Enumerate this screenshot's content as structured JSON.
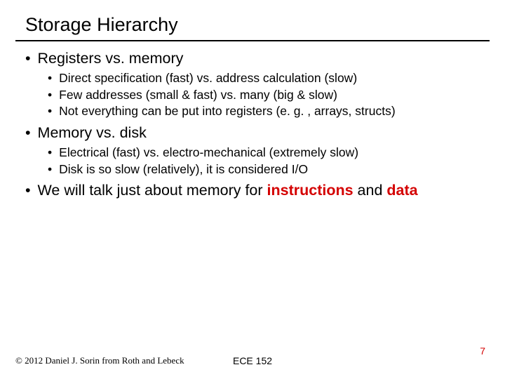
{
  "title": "Storage Hierarchy",
  "bullets": [
    {
      "text": "Registers vs. memory",
      "children": [
        "Direct specification (fast) vs. address calculation (slow)",
        "Few addresses (small & fast) vs. many (big & slow)",
        "Not everything can be put into registers (e. g. , arrays, structs)"
      ]
    },
    {
      "text": "Memory vs. disk",
      "children": [
        "Electrical (fast) vs. electro-mechanical (extremely slow)",
        "Disk is so slow (relatively), it is considered I/O"
      ]
    }
  ],
  "last_bullet": {
    "prefix": "We will talk just about memory for ",
    "word1": "instructions",
    "mid": " and ",
    "word2": "data"
  },
  "footer": {
    "copyright": "© 2012 Daniel J. Sorin from Roth and Lebeck",
    "course": "ECE 152",
    "page": "7"
  },
  "glyphs": {
    "bullet": "•"
  }
}
